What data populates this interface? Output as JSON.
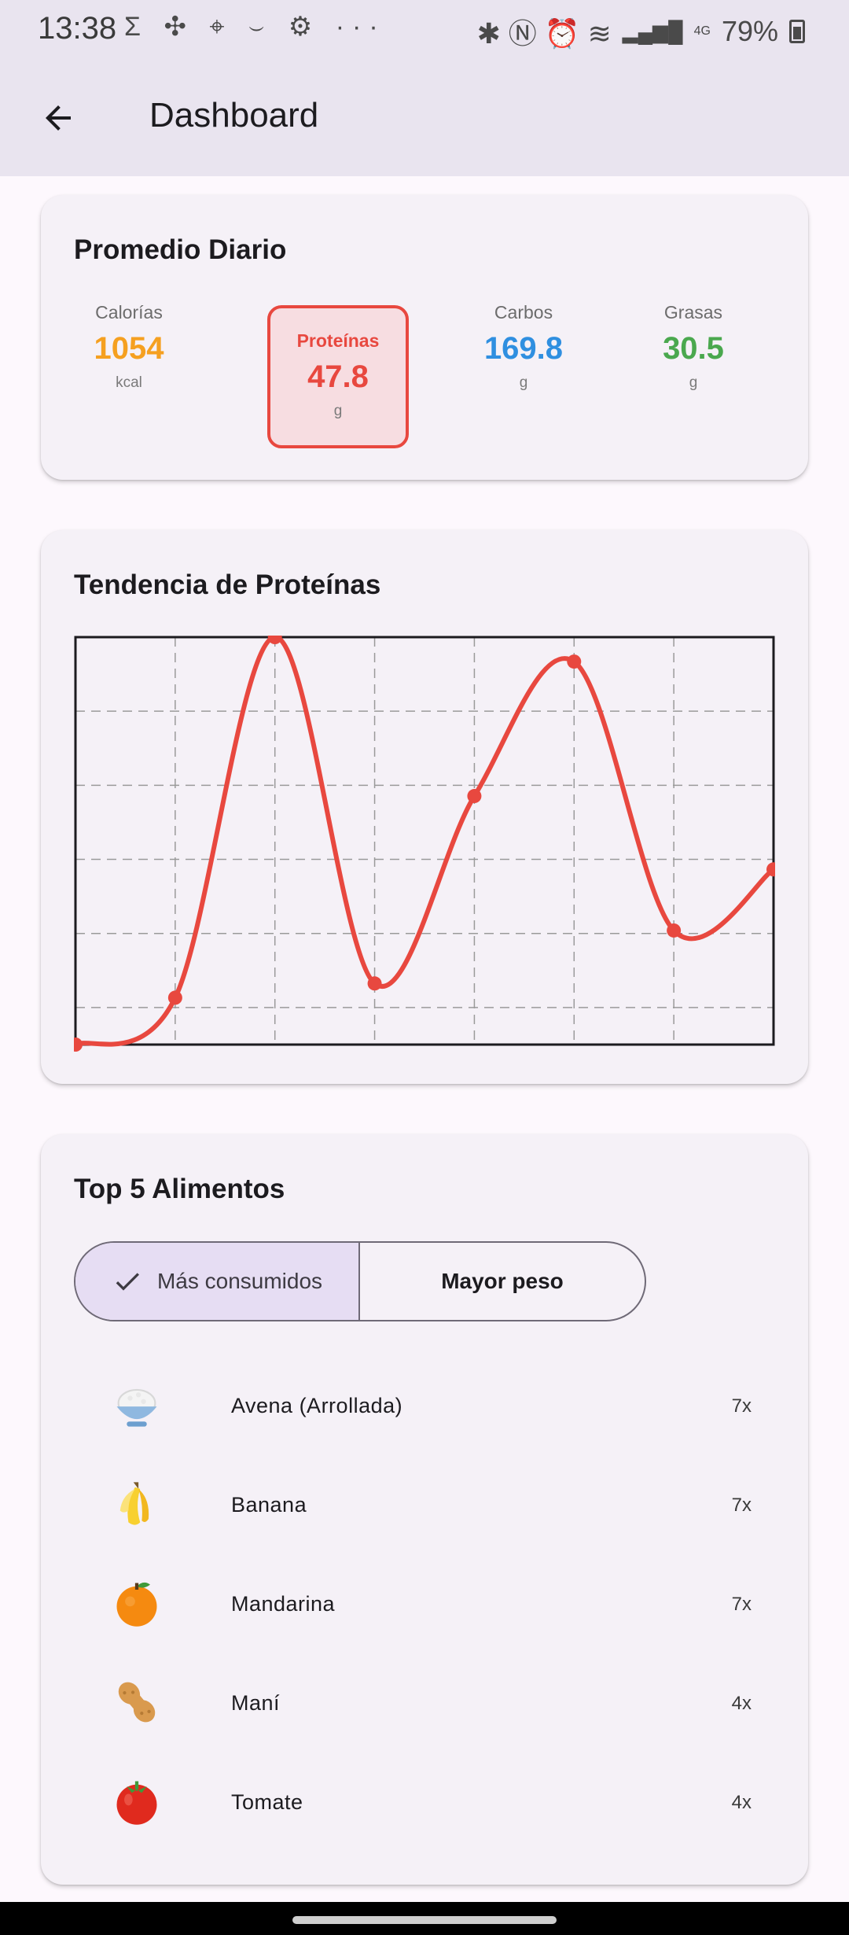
{
  "status_bar": {
    "time": "13:38",
    "left_icons": "Σ ✣ ⌖ ⌣ ⚙ ···",
    "right_icons": "✱ Ⓝ ⏰ ≋",
    "signal": "▂▄▆█",
    "network": "4G",
    "battery": "79%"
  },
  "app_bar": {
    "back_icon": "arrow-back-icon",
    "title": "Dashboard"
  },
  "daily_average": {
    "title": "Promedio Diario",
    "macros": [
      {
        "label": "Calorías",
        "value": "1054",
        "unit": "kcal",
        "color": "#f5a020",
        "selected": false
      },
      {
        "label": "Proteínas",
        "value": "47.8",
        "unit": "g",
        "color": "#e8483f",
        "selected": true
      },
      {
        "label": "Carbos",
        "value": "169.8",
        "unit": "g",
        "color": "#2f8fe0",
        "selected": false
      },
      {
        "label": "Grasas",
        "value": "30.5",
        "unit": "g",
        "color": "#4aa84e",
        "selected": false
      }
    ]
  },
  "trend": {
    "title": "Tendencia de Proteínas"
  },
  "chart_data": {
    "type": "line",
    "x": [
      0,
      1,
      2,
      3,
      4,
      5,
      6,
      7
    ],
    "series": [
      {
        "values": [
          0.0,
          0.115,
          1.0,
          0.15,
          0.61,
          0.94,
          0.28,
          0.43
        ]
      }
    ],
    "ylim": [
      0,
      1
    ],
    "grid": true,
    "color": "#e8483f",
    "smooth": true
  },
  "top_foods": {
    "title": "Top 5 Alimentos",
    "tabs": [
      {
        "label": "Más consumidos",
        "active": true,
        "icon": "check-icon"
      },
      {
        "label": "Mayor peso",
        "active": false
      }
    ],
    "items": [
      {
        "icon": "rice-bowl-icon",
        "name": "Avena (Arrollada)",
        "count": "7x"
      },
      {
        "icon": "banana-icon",
        "name": "Banana",
        "count": "7x"
      },
      {
        "icon": "tangerine-icon",
        "name": "Mandarina",
        "count": "7x"
      },
      {
        "icon": "peanut-icon",
        "name": "Maní",
        "count": "4x"
      },
      {
        "icon": "tomato-icon",
        "name": "Tomate",
        "count": "4x"
      }
    ]
  }
}
